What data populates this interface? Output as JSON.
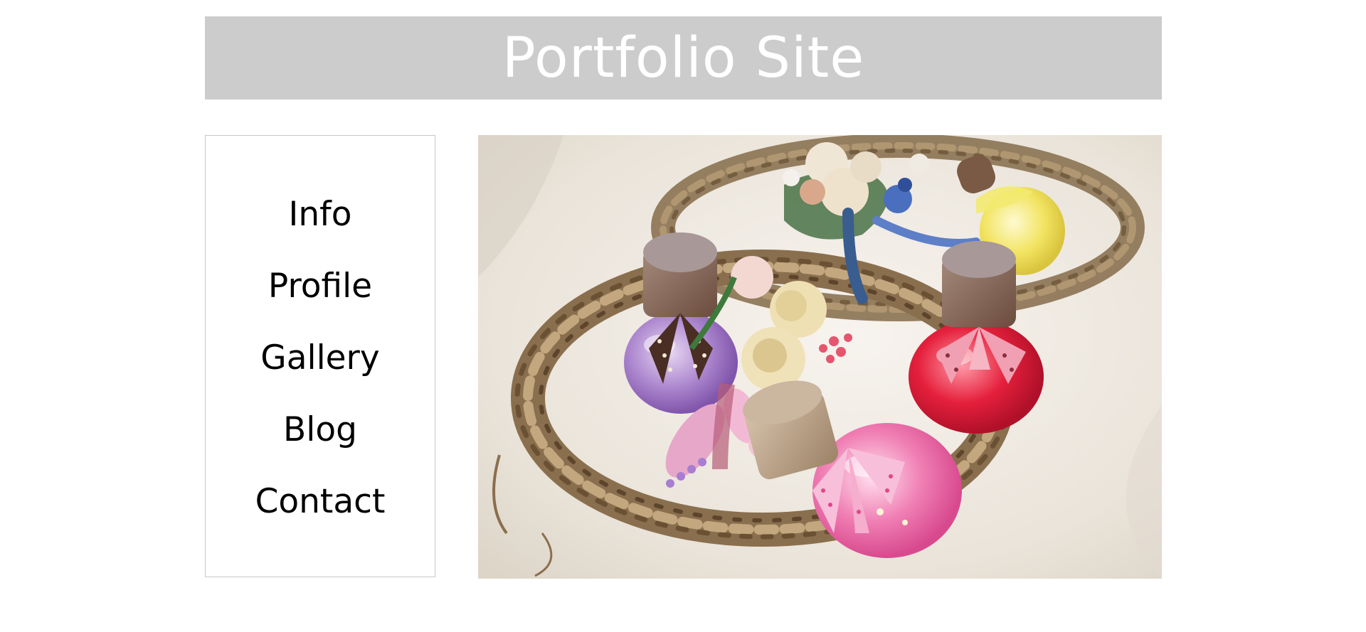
{
  "header": {
    "title": "Portfolio Site"
  },
  "nav": {
    "items": [
      {
        "label": "Info"
      },
      {
        "label": "Profile"
      },
      {
        "label": "Gallery"
      },
      {
        "label": "Blog"
      },
      {
        "label": "Contact"
      }
    ]
  },
  "colors": {
    "header_bg": "#cccccc",
    "header_text": "#ffffff",
    "nav_border": "#c8c8c8",
    "nav_text": "#000000"
  }
}
